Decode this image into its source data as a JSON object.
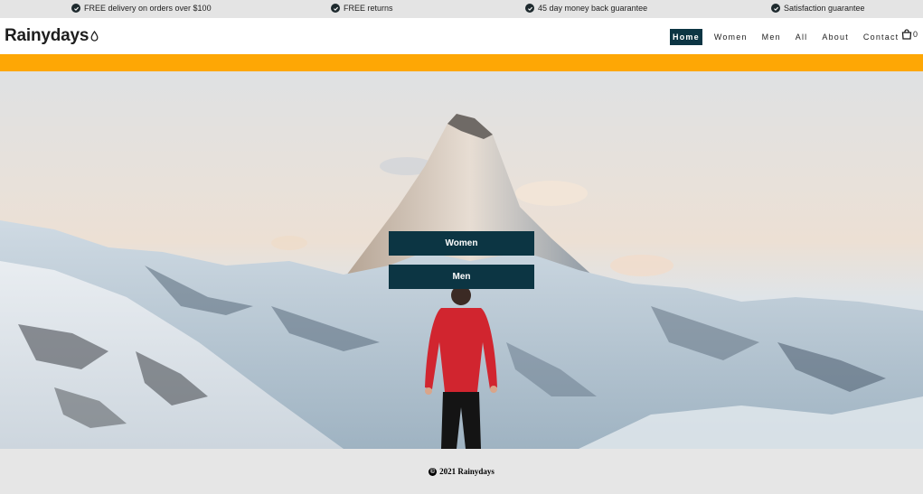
{
  "topbar": {
    "perks": [
      {
        "label": "FREE delivery on orders over $100",
        "icon": "check-circle-icon"
      },
      {
        "label": "FREE returns",
        "icon": "check-circle-icon"
      },
      {
        "label": "45 day money back guarantee",
        "icon": "check-circle-icon"
      },
      {
        "label": "Satisfaction guarantee",
        "icon": "check-circle-icon"
      }
    ]
  },
  "header": {
    "logo": "Rainydays",
    "logo_icon": "raindrop-icon",
    "nav": [
      {
        "label": "Home",
        "active": true
      },
      {
        "label": "Women",
        "active": false
      },
      {
        "label": "Men",
        "active": false
      },
      {
        "label": "All",
        "active": false
      },
      {
        "label": "About",
        "active": false
      },
      {
        "label": "Contact",
        "active": false
      }
    ],
    "cart_icon": "shopping-bag-icon",
    "cart_count": "0"
  },
  "hero": {
    "buttons": {
      "women": "Women",
      "men": "Men"
    }
  },
  "footer": {
    "copyright": "2021 Rainydays",
    "icon": "copyright-icon"
  },
  "colors": {
    "brand_dark": "#0c3543",
    "accent_orange": "#fea705",
    "topbar_bg": "#e4e4e4",
    "footer_bg": "#e6e6e6"
  }
}
